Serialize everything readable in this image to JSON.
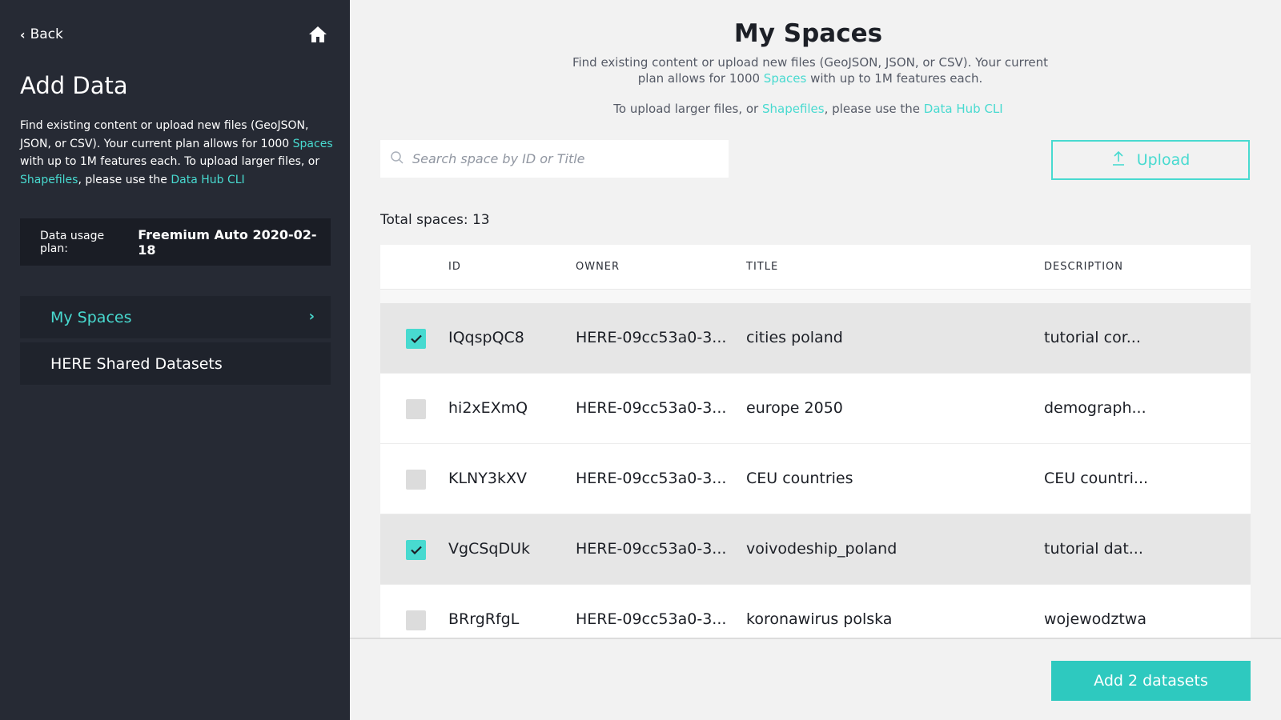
{
  "sidebar": {
    "back_label": "Back",
    "title": "Add Data",
    "desc": {
      "part1": "Find existing content or upload new files (GeoJSON, JSON, or CSV). Your current plan allows for 1000 ",
      "link_spaces": "Spaces",
      "part2": " with up to 1M features each. To upload larger files, or ",
      "link_shapefiles": "Shapefiles",
      "part3": ", please use the ",
      "link_cli": "Data Hub CLI"
    },
    "plan_label": "Data usage plan:",
    "plan_value": "Freemium Auto 2020-02-18",
    "nav": [
      {
        "label": "My Spaces",
        "active": true
      },
      {
        "label": "HERE Shared Datasets",
        "active": false
      }
    ]
  },
  "main": {
    "title": "My Spaces",
    "desc": {
      "part1": "Find existing content or upload new files (GeoJSON, JSON, or CSV). Your current plan allows for 1000 ",
      "link_spaces": "Spaces",
      "part2": " with up to 1M features each."
    },
    "desc2": {
      "part1": "To upload larger files, or ",
      "link_shapefiles": "Shapefiles",
      "part2": ", please use the ",
      "link_cli": "Data Hub CLI"
    },
    "search_placeholder": "Search space by ID or Title",
    "upload_label": "Upload",
    "total_label": "Total spaces: 13",
    "columns": {
      "id": "ID",
      "owner": "OWNER",
      "title": "TITLE",
      "description": "DESCRIPTION"
    },
    "rows": [
      {
        "id": "IQqspQC8",
        "owner": "HERE-09cc53a0-3...",
        "title": "cities poland",
        "description": "tutorial cor...",
        "checked": true
      },
      {
        "id": "hi2xEXmQ",
        "owner": "HERE-09cc53a0-3...",
        "title": "europe 2050",
        "description": "demograph...",
        "checked": false
      },
      {
        "id": "KLNY3kXV",
        "owner": "HERE-09cc53a0-3...",
        "title": "CEU countries",
        "description": "CEU countri...",
        "checked": false
      },
      {
        "id": "VgCSqDUk",
        "owner": "HERE-09cc53a0-3...",
        "title": "voivodeship_poland",
        "description": "tutorial dat...",
        "checked": true
      },
      {
        "id": "BRrgRfgL",
        "owner": "HERE-09cc53a0-3...",
        "title": "koronawirus polska",
        "description": "wojewodztwa",
        "checked": false
      }
    ],
    "add_button_label": "Add 2 datasets"
  },
  "colors": {
    "accent": "#48dad0",
    "sidebar_bg": "#262a34",
    "selected_row": "#e6e6e6"
  },
  "icons": {
    "back": "chevron-left-icon",
    "home": "home-icon",
    "nav_arrow": "chevron-right-icon",
    "search": "search-icon",
    "upload": "upload-icon",
    "check": "check-icon"
  }
}
